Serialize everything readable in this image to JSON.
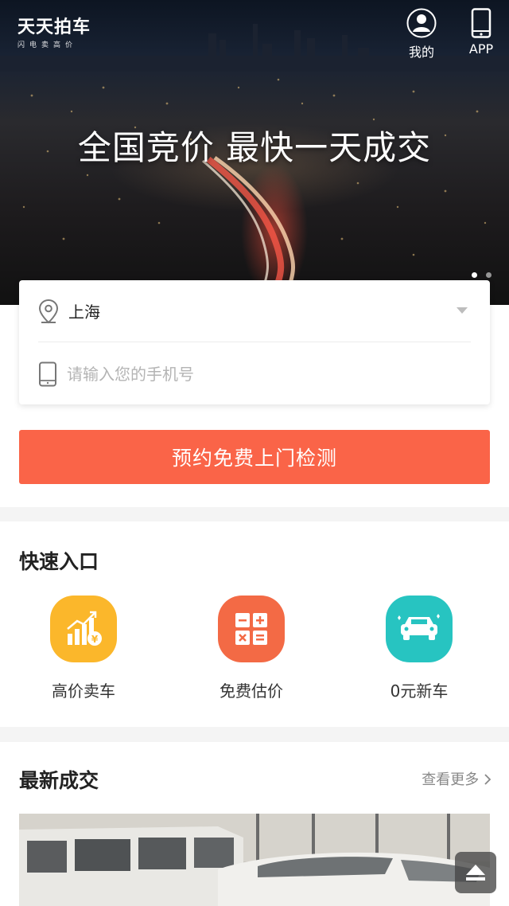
{
  "brand": {
    "name": "天天拍车",
    "tagline": "闪电卖高价"
  },
  "header": {
    "me_label": "我的",
    "app_label": "APP"
  },
  "hero": {
    "headline": "全国竞价 最快一天成交",
    "carousel_pages": 2,
    "active_page": 1
  },
  "form": {
    "city_value": "上海",
    "phone_placeholder": "请输入您的手机号",
    "phone_value": "",
    "submit_label": "预约免费上门检测"
  },
  "quick_entry": {
    "title": "快速入口",
    "items": [
      {
        "label": "高价卖车",
        "icon": "chart-coin-icon",
        "color": "#fbb72b"
      },
      {
        "label": "免费估价",
        "icon": "calculator-icon",
        "color": "#f36a45"
      },
      {
        "label": "0元新车",
        "icon": "sparkle-car-icon",
        "color": "#27c4c1"
      }
    ]
  },
  "latest": {
    "title": "最新成交",
    "more_label": "查看更多"
  },
  "colors": {
    "primary": "#fa6448",
    "background": "#f4f4f4"
  }
}
